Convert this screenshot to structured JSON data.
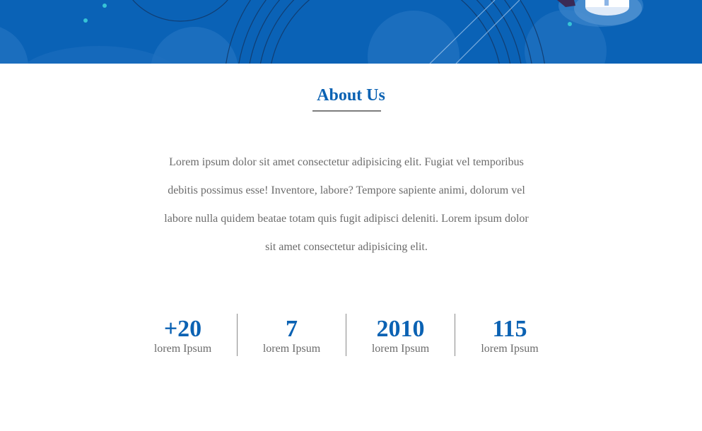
{
  "hero": {
    "background_color": "#0a62b6"
  },
  "about": {
    "title": "About Us",
    "body": "Lorem ipsum dolor sit amet consectetur adipisicing elit. Fugiat vel temporibus debitis possimus esse! Inventore, labore? Tempore sapiente animi, dolorum vel labore nulla quidem beatae totam quis fugit adipisci deleniti. Lorem ipsum dolor sit amet consectetur adipisicing elit."
  },
  "stats": [
    {
      "value": "+20",
      "label": "lorem Ipsum"
    },
    {
      "value": "7",
      "label": "lorem Ipsum"
    },
    {
      "value": "2010",
      "label": "lorem Ipsum"
    },
    {
      "value": "115",
      "label": "lorem Ipsum"
    }
  ],
  "colors": {
    "accent": "#0b62b3",
    "text": "#6b6b6b",
    "divider": "#8a8a8a"
  }
}
